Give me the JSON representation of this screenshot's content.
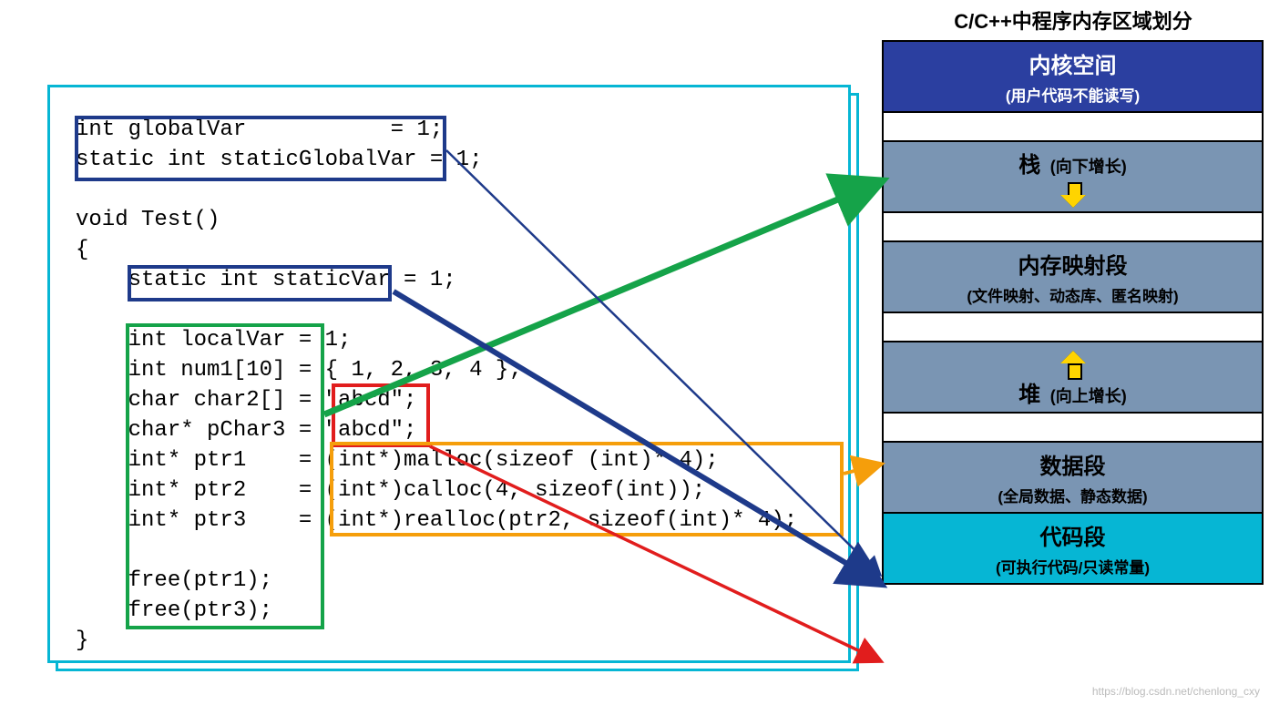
{
  "title": "C/C++中程序内存区域划分",
  "code": "int globalVar           = 1;\nstatic int staticGlobalVar = 1;\n\nvoid Test()\n{\n    static int staticVar = 1;\n\n    int localVar = 1;\n    int num1[10] = { 1, 2, 3, 4 };\n    char char2[] = \"abcd\";\n    char* pChar3 = \"abcd\";\n    int* ptr1    = (int*)malloc(sizeof (int)* 4);\n    int* ptr2    = (int*)calloc(4, sizeof(int));\n    int* ptr3    = (int*)realloc(ptr2, sizeof(int)* 4);\n\n    free(ptr1);\n    free(ptr3);\n}",
  "segments": {
    "kernel": {
      "title": "内核空间",
      "sub": "(用户代码不能读写)"
    },
    "stack": {
      "title": "栈",
      "sub": "(向下增长)"
    },
    "mmap": {
      "title": "内存映射段",
      "sub": "(文件映射、动态库、匿名映射)"
    },
    "heap": {
      "title": "堆",
      "sub": "(向上增长)"
    },
    "data": {
      "title": "数据段",
      "sub": "(全局数据、静态数据)"
    },
    "text": {
      "title": "代码段",
      "sub": "(可执行代码/只读常量)"
    }
  },
  "boxes": {
    "globals": {
      "color": "blue",
      "target": "数据段",
      "contains": [
        "int globalVar",
        "static int staticGlobalVar"
      ]
    },
    "staticVar": {
      "color": "blue",
      "target": "数据段",
      "contains": [
        "static int staticVar"
      ]
    },
    "locals": {
      "color": "green",
      "target": "栈",
      "contains": [
        "int localVar",
        "int num1[10]",
        "char char2[]",
        "char* pChar3",
        "int* ptr1",
        "int* ptr2",
        "int* ptr3",
        "free(ptr1)",
        "free(ptr3)"
      ]
    },
    "literals": {
      "color": "red",
      "target": "代码段",
      "contains": [
        "\"abcd\"",
        "\"abcd\""
      ]
    },
    "heapcalls": {
      "color": "orange",
      "target": "堆",
      "contains": [
        "(int*)malloc(sizeof (int)* 4)",
        "(int*)calloc(4, sizeof(int))",
        "(int*)realloc(ptr2, sizeof(int)* 4)"
      ]
    }
  },
  "watermark": "https://blog.csdn.net/chenlong_cxy",
  "chart_data": {
    "type": "diagram",
    "regions_top_to_bottom": [
      "内核空间",
      "栈",
      "内存映射段",
      "堆",
      "数据段",
      "代码段"
    ],
    "mappings": [
      {
        "code_group": "globals",
        "memory_region": "数据段"
      },
      {
        "code_group": "staticVar",
        "memory_region": "数据段"
      },
      {
        "code_group": "locals",
        "memory_region": "栈"
      },
      {
        "code_group": "literals",
        "memory_region": "代码段"
      },
      {
        "code_group": "heapcalls",
        "memory_region": "堆"
      }
    ]
  }
}
